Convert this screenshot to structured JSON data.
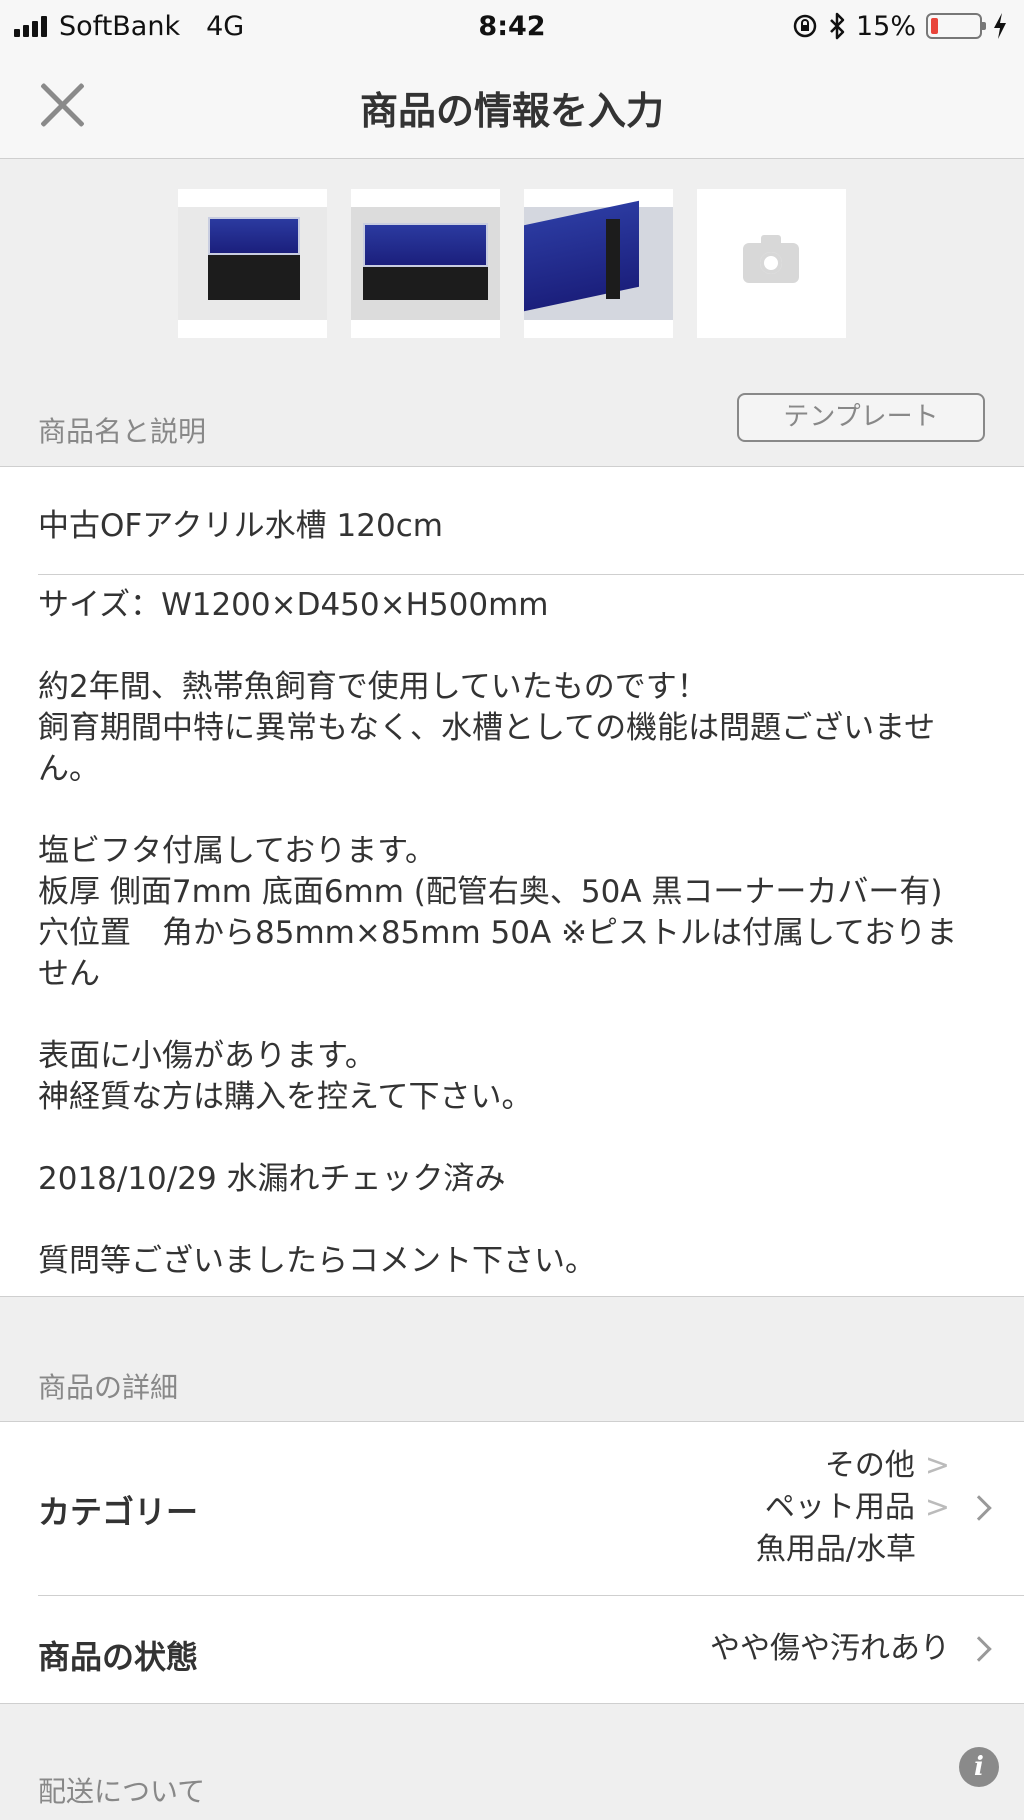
{
  "status_bar": {
    "carrier": "SoftBank",
    "network": "4G",
    "time": "8:42",
    "battery_percent": "15%",
    "battery_level": 0.15
  },
  "header": {
    "title": "商品の情報を入力"
  },
  "photos": {
    "thumbnails": [
      "aquarium-photo-1",
      "aquarium-photo-2",
      "aquarium-photo-3"
    ],
    "add_icon": "camera-icon"
  },
  "description_section": {
    "label": "商品名と説明",
    "template_button": "テンプレート",
    "item_name": "中古OFアクリル水槽 120cm",
    "description_lines": [
      "サイズ：W1200×D450×H500mm",
      "",
      "約2年間、熱帯魚飼育で使用していたものです！",
      "飼育期間中特に異常もなく、水槽としての機能は問題ございませ",
      "ん。",
      "",
      "塩ビフタ付属しております。",
      "板厚 側面7mm 底面6mm (配管右奥、50A 黒コーナーカバー有)",
      "穴位置　角から85mm×85mm 50A ※ピストルは付属しておりま",
      "せん",
      "",
      "表面に小傷があります。",
      "神経質な方は購入を控えて下さい。",
      "",
      "2018/10/29 水漏れチェック済み",
      "",
      "質問等ございましたらコメント下さい。"
    ]
  },
  "details_section": {
    "label": "商品の詳細",
    "category": {
      "label": "カテゴリー",
      "path": [
        "その他",
        "ペット用品",
        "魚用品/水草"
      ],
      "separator": ">"
    },
    "condition": {
      "label": "商品の状態",
      "value": "やや傷や汚れあり"
    }
  },
  "shipping_section": {
    "label": "配送について",
    "info_icon": "i"
  },
  "colors": {
    "background": "#efefef",
    "text": "#333333",
    "muted": "#888888",
    "battery_low": "#e8443a"
  }
}
